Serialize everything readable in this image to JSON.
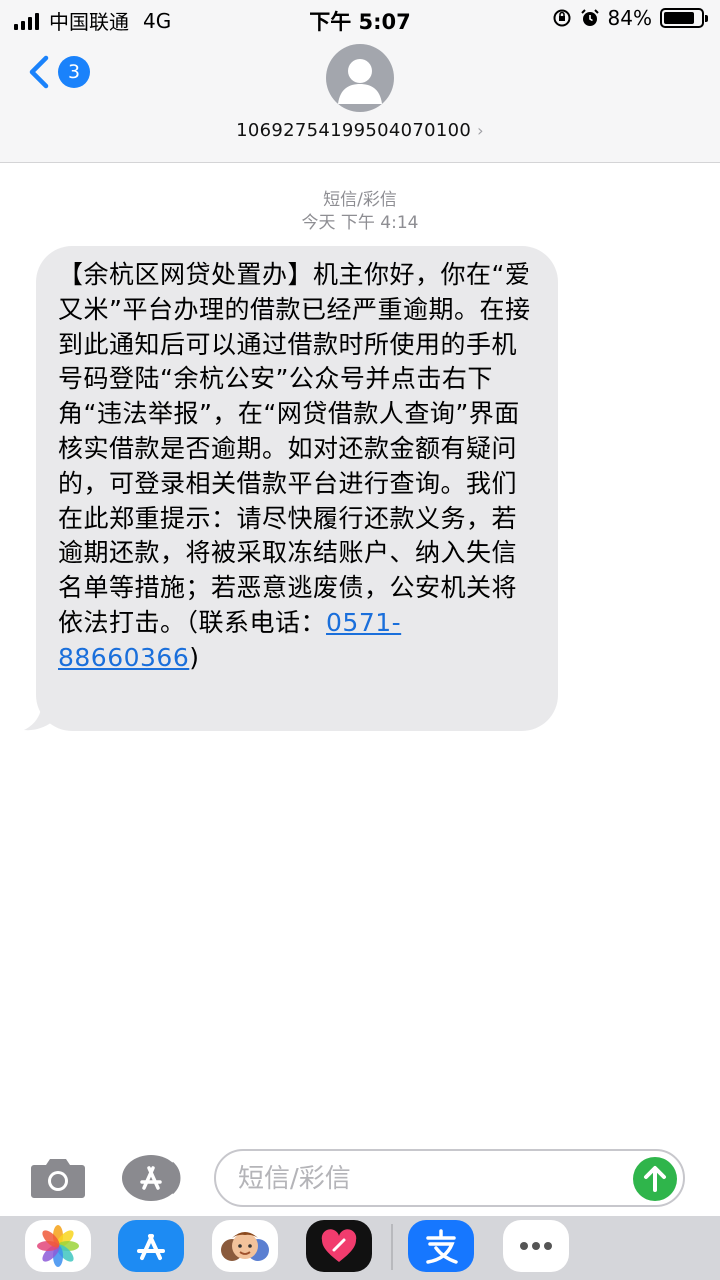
{
  "status_bar": {
    "carrier": "中国联通",
    "network": "4G",
    "time": "下午 5:07",
    "battery": "84%",
    "battery_level": 0.84,
    "icons": [
      "signal-icon",
      "orientation-lock-icon",
      "alarm-icon",
      "battery-icon"
    ]
  },
  "header": {
    "back_badge": "3",
    "contact_number": "1069275419950407010​0",
    "contact_chevron": "›"
  },
  "thread": {
    "service_label": "短信/彩信",
    "timestamp": "今天 下午 4:14",
    "message_text": "【余杭区网贷处置办】机主你好，你在“爱又米”平台办理的借款已经严重逾期。在接到此通知后可以通过借款时所使用的手机号码登陆“余杭公安”公众号并点击右下角“违法举报”，在“网贷借款人查询”界面核实借款是否逾期。如对还款金额有疑问的，可登录相关借款平台进行查询。我们在此郑重提示：请尽快履行还款义务，若逾期还款，将被采取冻结账户、纳入失信名单等措施；若恶意逃废债，公安机关将依法打击。（联系电话：",
    "phone_link": "0571-88660366",
    "message_end": ")"
  },
  "compose": {
    "placeholder": "短信/彩信",
    "value": ""
  },
  "app_drawer": {
    "apps": [
      "photos-app-icon",
      "app-store-icon",
      "memoji-icon",
      "digital-touch-icon",
      "alipay-icon",
      "more-apps-icon"
    ]
  },
  "colors": {
    "accent": "#1a82fb",
    "bubble": "#e9e9eb",
    "send": "#2fb54b",
    "link": "#1a6fdb"
  }
}
